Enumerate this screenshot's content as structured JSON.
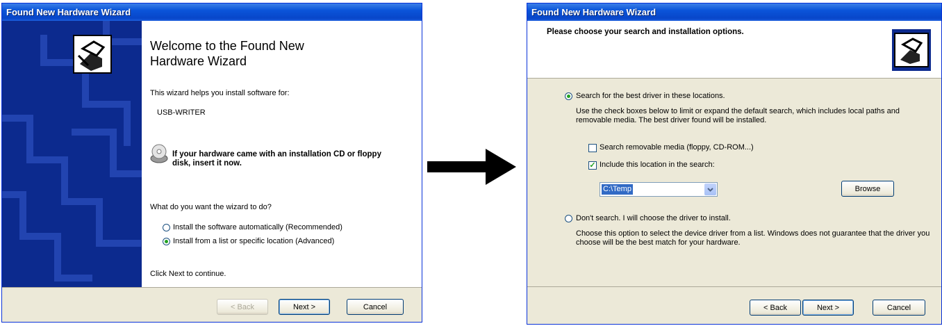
{
  "left_window": {
    "title": "Found New Hardware Wizard",
    "heading": "Welcome to the Found New Hardware Wizard",
    "intro": "This wizard helps you install software for:",
    "device": "USB-WRITER",
    "cd_notice": "If your hardware came with an installation CD or floppy disk, insert it now.",
    "question": "What do you want the wizard to do?",
    "option_auto": "Install the software automatically (Recommended)",
    "option_list": "Install from a list or specific location (Advanced)",
    "selected_option": "option_list",
    "continue_text": "Click Next to continue.",
    "back_label": "< Back",
    "next_label": "Next >",
    "cancel_label": "Cancel"
  },
  "arrow_icon": "right-arrow-icon",
  "right_window": {
    "title": "Found New Hardware Wizard",
    "header": "Please choose your search and installation options.",
    "option_search": "Search for the best driver in these locations.",
    "search_desc": "Use the check boxes below to limit or expand the default search, which includes local paths and removable media. The best driver found will be installed.",
    "check_removable": "Search removable media (floppy, CD-ROM...)",
    "check_removable_checked": false,
    "check_location": "Include this location in the search:",
    "check_location_checked": true,
    "location_value": "C:\\Temp",
    "browse_label": "Browse",
    "option_dont": "Don't search. I will choose the driver to install.",
    "dont_desc": "Choose this option to select the device driver from a list.  Windows does not guarantee that the driver you choose will be the best match for your hardware.",
    "back_label": "< Back",
    "next_label": "Next >",
    "cancel_label": "Cancel"
  }
}
